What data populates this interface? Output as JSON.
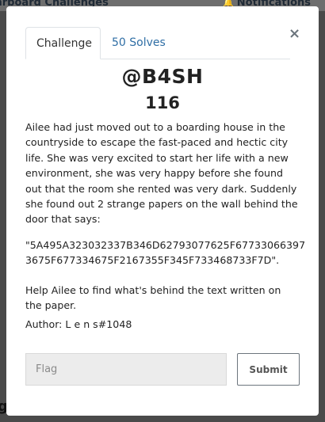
{
  "background": {
    "nav_left_text": "arboard   Challenges",
    "nav_right_text": "Notifications"
  },
  "modal": {
    "tabs": [
      {
        "label": "Challenge",
        "active": true
      },
      {
        "label": "50 Solves",
        "active": false
      }
    ],
    "close_label": "×",
    "challenge": {
      "name": "@B4SH",
      "points": "116",
      "description": [
        "Ailee had just moved out to a boarding house in the countryside to escape the fast-paced and hectic city life. She was very excited to start her life with a new environment, she was very happy before she found out that the room she rented was very dark. Suddenly she found out 2 strange papers on the wall behind the door that says:",
        "\"5A495A323032337B346D62793077625F67733066397 3675F677334675F2167355F345F733468733F7D\".",
        "Help Ailee to find what's behind the text written on the paper."
      ],
      "author": "Author: L e n s#1048"
    },
    "flag_input": {
      "placeholder": "Flag",
      "value": ""
    },
    "submit_label": "Submit"
  },
  "colors": {
    "overlay": "#4a4a4a",
    "modal_bg": "#ffffff",
    "tab_link": "#2f6ea5",
    "input_bg": "#ececec"
  }
}
